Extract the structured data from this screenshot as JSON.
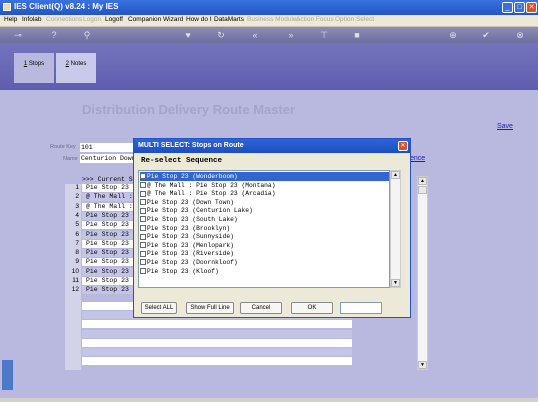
{
  "window": {
    "title": "IES Client(Q) v8.24 : My IES"
  },
  "menu": [
    {
      "label": "Help",
      "enabled": true
    },
    {
      "label": "Infolab",
      "enabled": true
    },
    {
      "label": "Connections",
      "enabled": false
    },
    {
      "label": "Logon",
      "enabled": false
    },
    {
      "label": "Logoff",
      "enabled": true
    },
    {
      "label": "Companion",
      "enabled": true
    },
    {
      "label": "Wizard",
      "enabled": true
    },
    {
      "label": "How do I",
      "enabled": true
    },
    {
      "label": "DataMarts",
      "enabled": true
    },
    {
      "label": "Business Modules",
      "enabled": false
    },
    {
      "label": "Action Focus",
      "enabled": false
    },
    {
      "label": "Option Select",
      "enabled": false
    }
  ],
  "tabs": [
    {
      "number": "1",
      "label": "Stops"
    },
    {
      "number": "2",
      "label": "Notes"
    }
  ],
  "page": {
    "title": "Distribution Delivery Route Master",
    "save_label": "Save",
    "route_key_label": "Route Key",
    "route_key_value": "101",
    "name_label": "Name",
    "name_value": "Centurion Down",
    "sequence_link": "ence"
  },
  "grid": {
    "header": ">>> Current St",
    "rows": [
      {
        "num": "1",
        "text": "Pie Stop 23"
      },
      {
        "num": "2",
        "text": "@ The Mall :"
      },
      {
        "num": "3",
        "text": "@ The Mall :"
      },
      {
        "num": "4",
        "text": "Pie Stop 23"
      },
      {
        "num": "5",
        "text": "Pie Stop 23"
      },
      {
        "num": "6",
        "text": "Pie Stop 23"
      },
      {
        "num": "7",
        "text": "Pie Stop 23"
      },
      {
        "num": "8",
        "text": "Pie Stop 23"
      },
      {
        "num": "9",
        "text": "Pie Stop 23"
      },
      {
        "num": "10",
        "text": "Pie Stop 23"
      },
      {
        "num": "11",
        "text": "Pie Stop 23"
      },
      {
        "num": "12",
        "text": "Pie Stop 23"
      }
    ]
  },
  "dialog": {
    "title": "MULTI SELECT: Stops on Route",
    "subtitle": "Re-select Sequence",
    "items": [
      {
        "label": "Pie Stop 23 (Wonderboom)",
        "selected": true
      },
      {
        "label": "@ The Mall : Pie Stop 23 (Montana)",
        "selected": false
      },
      {
        "label": "@ The Mall : Pie Stop 23 (Arcadia)",
        "selected": false
      },
      {
        "label": "Pie Stop 23 (Down Town)",
        "selected": false
      },
      {
        "label": "Pie Stop 23 (Centurion Lake)",
        "selected": false
      },
      {
        "label": "Pie Stop 23 (South Lake)",
        "selected": false
      },
      {
        "label": "Pie Stop 23 (Brooklyn)",
        "selected": false
      },
      {
        "label": "Pie Stop 23 (Sunnyside)",
        "selected": false
      },
      {
        "label": "Pie Stop 23 (Menlopark)",
        "selected": false
      },
      {
        "label": "Pie Stop 23 (Riverside)",
        "selected": false
      },
      {
        "label": "Pie Stop 23 (Doornkloof)",
        "selected": false
      },
      {
        "label": "Pie Stop 23 (Kloof)",
        "selected": false
      }
    ],
    "buttons": {
      "select_all": "Select ALL",
      "show_full_line": "Show Full Line",
      "cancel": "Cancel",
      "ok": "OK"
    },
    "input_value": ""
  },
  "colors": {
    "accent": "#2153c8",
    "selection": "#3366cc",
    "page_bg": "#b9b9e0"
  }
}
